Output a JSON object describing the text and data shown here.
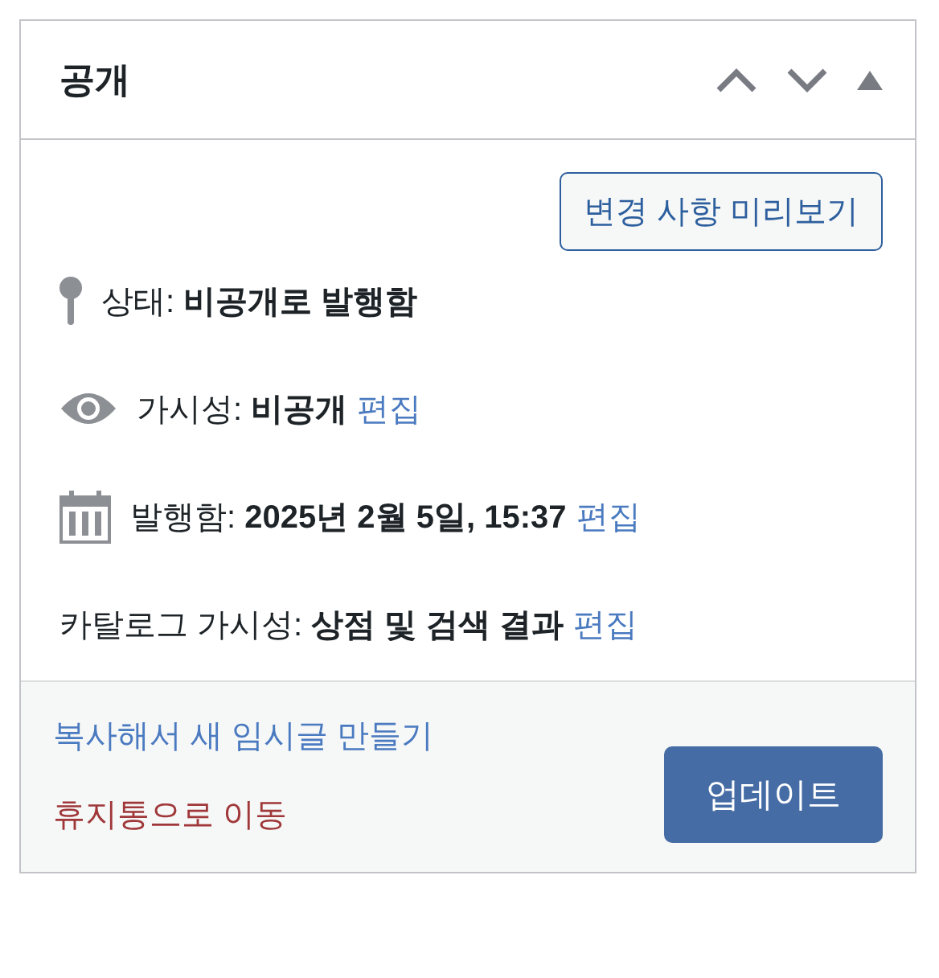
{
  "panel": {
    "title": "공개"
  },
  "preview_button": "변경 사항 미리보기",
  "rows": [
    {
      "kind": "pin",
      "text": "상태: **비공개로 발행함**"
    },
    {
      "kind": "eye",
      "text": "가시성: **비공개**",
      "link": "편집"
    },
    {
      "kind": "calendar",
      "text": "발행함: **2025년 2월 5일, 15:37**",
      "link": "편집"
    },
    {
      "kind": "none",
      "text": "카탈로그 가시성: **상점 및 검색 결과**",
      "link": "편집"
    }
  ],
  "footer": {
    "copy_link": "복사해서 새 임시글 만들기",
    "trash_link": "휴지통으로 이동",
    "update_button": "업데이트"
  }
}
